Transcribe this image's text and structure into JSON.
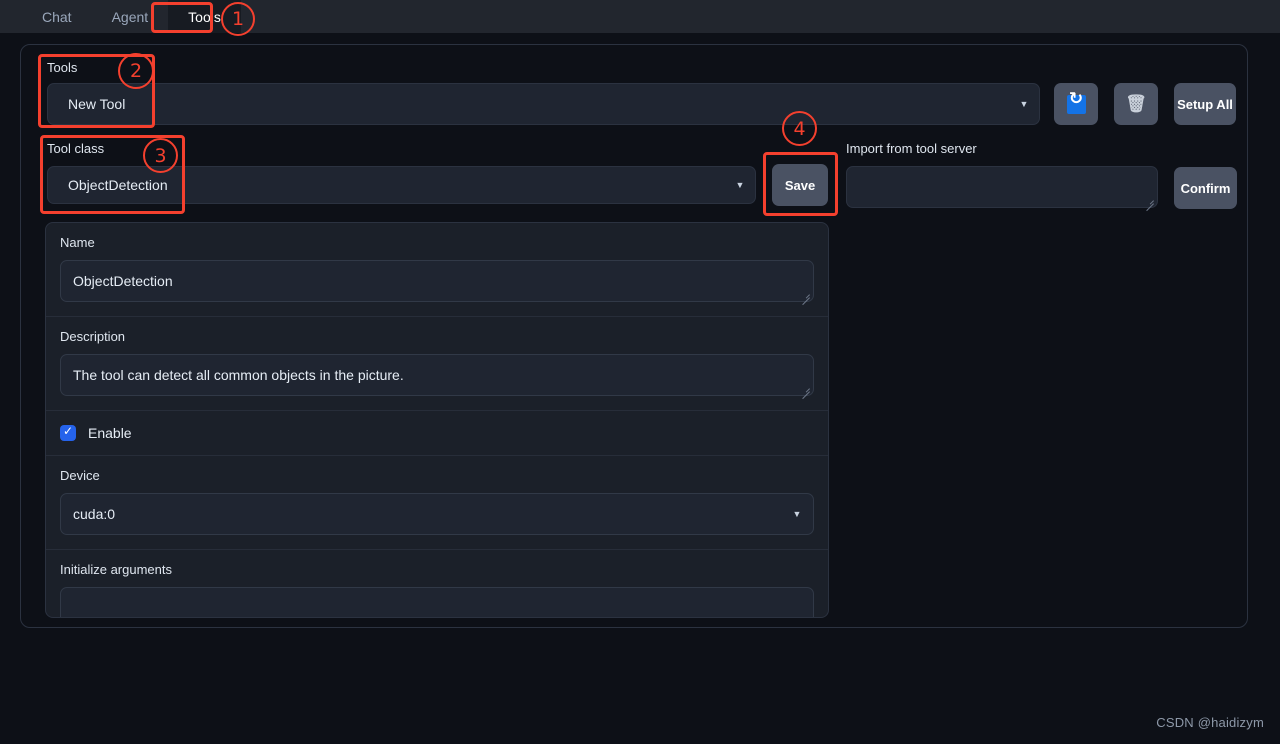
{
  "tabs": [
    {
      "label": "Chat",
      "active": false
    },
    {
      "label": "Agent",
      "active": false
    },
    {
      "label": "Tools",
      "active": true
    }
  ],
  "toolbar": {
    "tools_label": "Tools",
    "tools_value": "New Tool",
    "refresh_icon": "refresh-icon",
    "delete_icon": "trash-icon",
    "setup_all_label": "Setup All",
    "tool_class_label": "Tool class",
    "tool_class_value": "ObjectDetection",
    "save_label": "Save",
    "import_label": "Import from tool server",
    "import_value": "",
    "confirm_label": "Confirm"
  },
  "form": {
    "name_label": "Name",
    "name_value": "ObjectDetection",
    "description_label": "Description",
    "description_value": "The tool can detect all common objects in the picture.",
    "enable_label": "Enable",
    "enable_checked": true,
    "device_label": "Device",
    "device_value": "cuda:0",
    "init_args_label": "Initialize arguments",
    "init_args_value": ""
  },
  "annotations": [
    {
      "number": "①"
    },
    {
      "number": "②"
    },
    {
      "number": "③"
    },
    {
      "number": "④"
    }
  ],
  "watermark": "CSDN @haidizym",
  "colors": {
    "accent_red": "#f4402e",
    "checkbox_blue": "#2563eb",
    "refresh_blue": "#1473e6",
    "button_gray": "#4a5263",
    "page_bg": "#0d1017",
    "tabbar_bg": "#22262e"
  }
}
